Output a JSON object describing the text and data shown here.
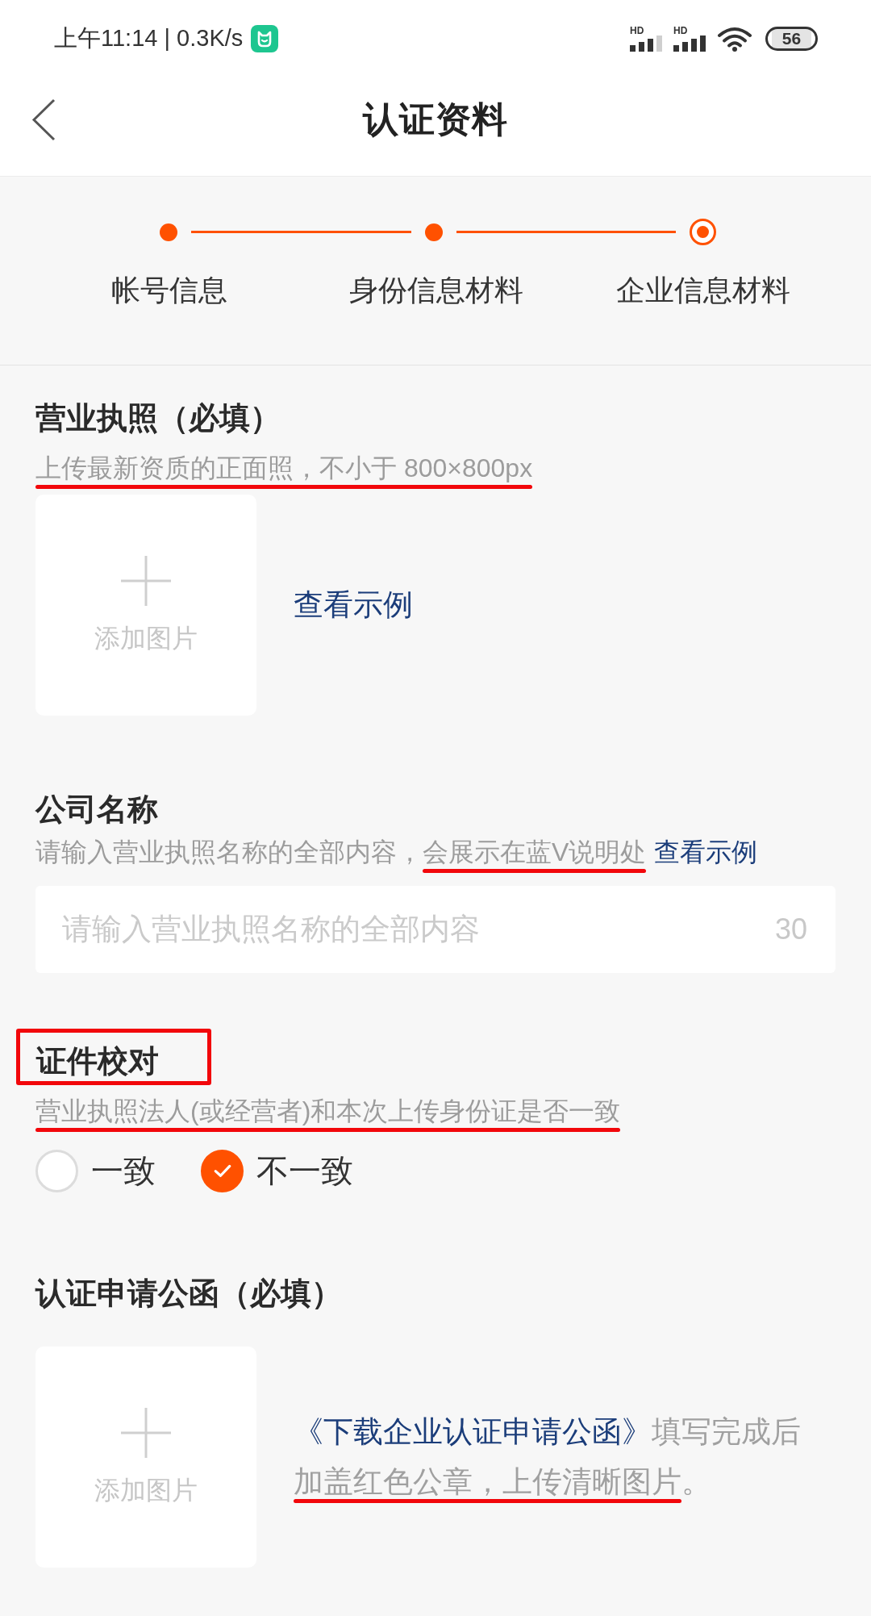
{
  "status_bar": {
    "time": "上午11:14 | 0.3K/s",
    "signals": [
      {
        "label": "HD"
      },
      {
        "label": "HD"
      }
    ],
    "battery": "56"
  },
  "nav": {
    "title": "认证资料"
  },
  "steps": [
    {
      "label": "帐号信息",
      "current": false
    },
    {
      "label": "身份信息材料",
      "current": false
    },
    {
      "label": "企业信息材料",
      "current": true
    }
  ],
  "sections": [
    {
      "kind": "upload",
      "title": "营业执照（必填）",
      "boxed": false,
      "hint": [
        {
          "kind": "text",
          "text": "上传最新资质的正面照，不小于 800×800px",
          "underlined": true
        }
      ],
      "upload_label": "添加图片",
      "aside": [
        {
          "kind": "link",
          "text": "查看示例",
          "underlined": false
        }
      ]
    },
    {
      "kind": "input",
      "title": "公司名称",
      "boxed": false,
      "hint": [
        {
          "kind": "text",
          "text": "请输入营业执照名称的全部内容，",
          "underlined": false
        },
        {
          "kind": "text",
          "text": "会展示在蓝V说明处",
          "underlined": true
        },
        {
          "kind": "link",
          "text": "查看示例",
          "underlined": false
        }
      ],
      "field": {
        "placeholder": "请输入营业执照名称的全部内容",
        "counter": "30"
      }
    },
    {
      "kind": "radio",
      "title": "证件校对",
      "boxed": true,
      "hint": [
        {
          "kind": "text",
          "text": "营业执照法人(或经营者)和本次上传身份证是否一致",
          "underlined": true
        }
      ],
      "options": [
        {
          "label": "一致",
          "selected": false
        },
        {
          "label": "不一致",
          "selected": true
        }
      ]
    },
    {
      "kind": "upload",
      "title": "认证申请公函（必填）",
      "boxed": false,
      "upload_label": "添加图片",
      "aside": [
        {
          "kind": "link",
          "text": "《下载企业认证申请公函》",
          "underlined": false
        },
        {
          "kind": "text",
          "text": "填写完成后",
          "underlined": false
        },
        {
          "kind": "text",
          "text": "加盖红色公章，上传清晰图片",
          "underlined": true
        },
        {
          "kind": "text",
          "text": "。",
          "underlined": false
        }
      ]
    }
  ]
}
